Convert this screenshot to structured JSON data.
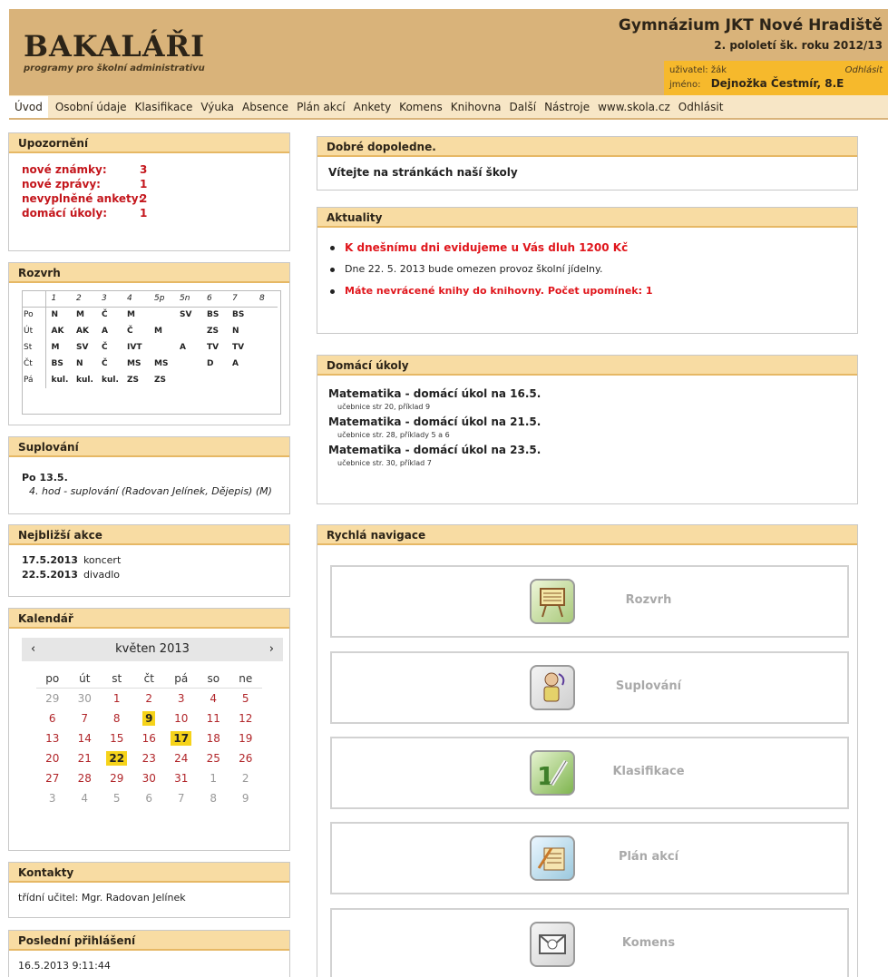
{
  "header": {
    "logo": "BAKALÁŘI",
    "logo_sub": "programy pro školní administrativu",
    "school": "Gymnázium JKT Nové Hradiště",
    "semester": "2. pololetí šk. roku 2012/13",
    "user_label": "uživatel:",
    "user_value": "žák",
    "logout": "Odhlásit",
    "name_label": "jméno:",
    "name_value": "Dejnožka Čestmír, 8.E"
  },
  "nav": [
    "Úvod",
    "Osobní údaje",
    "Klasifikace",
    "Výuka",
    "Absence",
    "Plán akcí",
    "Ankety",
    "Komens",
    "Knihovna",
    "Další",
    "Nástroje",
    "www.skola.cz",
    "Odhlásit"
  ],
  "upozorneni": {
    "title": "Upozornění",
    "rows": [
      {
        "label": "nové známky:",
        "value": "3"
      },
      {
        "label": "nové zprávy:",
        "value": "1"
      },
      {
        "label": "nevyplněné ankety:",
        "value": "2"
      },
      {
        "label": "domácí úkoly:",
        "value": "1"
      }
    ]
  },
  "rozvrh": {
    "title": "Rozvrh",
    "headers": [
      "1",
      "2",
      "3",
      "4",
      "5p",
      "5n",
      "6",
      "7",
      "8"
    ],
    "days": [
      {
        "day": "Po",
        "cells": [
          "N",
          "M",
          "Č",
          "M",
          "",
          "SV",
          "BS",
          "BS",
          ""
        ]
      },
      {
        "day": "Út",
        "cells": [
          "AK",
          "AK",
          "A",
          "Č",
          "M",
          "",
          "ZS",
          "N",
          ""
        ]
      },
      {
        "day": "St",
        "cells": [
          "M",
          "SV",
          "Č",
          "IVT",
          "",
          "A",
          "TV",
          "TV",
          ""
        ]
      },
      {
        "day": "Čt",
        "cells": [
          "BS",
          "N",
          "Č",
          "MS",
          "MS",
          "",
          "D",
          "A",
          ""
        ]
      },
      {
        "day": "Pá",
        "cells": [
          "kul.",
          "kul.",
          "kul.",
          "ZS",
          "ZS",
          "",
          "",
          "",
          ""
        ]
      }
    ]
  },
  "suplovani": {
    "title": "Suplování",
    "date": "Po 13.5.",
    "line": "4. hod - suplování (Radovan Jelínek, Dějepis) (M)"
  },
  "akce": {
    "title": "Nejbližší akce",
    "rows": [
      {
        "date": "17.5.2013",
        "name": "koncert"
      },
      {
        "date": "22.5.2013",
        "name": "divadlo"
      }
    ]
  },
  "kalendar": {
    "title": "Kalendář",
    "month": "květen 2013",
    "prev": "‹",
    "next": "›",
    "dow": [
      "po",
      "út",
      "st",
      "čt",
      "pá",
      "so",
      "ne"
    ],
    "days": [
      "29",
      "30",
      "1",
      "2",
      "3",
      "4",
      "5",
      "6",
      "7",
      "8",
      "9",
      "10",
      "11",
      "12",
      "13",
      "14",
      "15",
      "16",
      "17",
      "18",
      "19",
      "20",
      "21",
      "22",
      "23",
      "24",
      "25",
      "26",
      "27",
      "28",
      "29",
      "30",
      "31",
      "1",
      "2",
      "3",
      "4",
      "5",
      "6",
      "7",
      "8",
      "9"
    ]
  },
  "kontakty": {
    "title": "Kontakty",
    "text": "třídní učitel: Mgr. Radovan Jelínek"
  },
  "prihlaseni": {
    "title": "Poslední přihlášení",
    "text": "16.5.2013 9:11:44"
  },
  "greeting": {
    "title": "Dobré dopoledne.",
    "text": "Vítejte na stránkách naší školy"
  },
  "aktuality": {
    "title": "Aktuality",
    "items": [
      "K dnešnímu dni evidujeme u Vás dluh 1200 Kč",
      "Dne 22. 5. 2013 bude omezen provoz školní jídelny.",
      "Máte nevrácené knihy do knihovny. Počet upomínek: 1"
    ]
  },
  "ukoly": {
    "title": "Domácí úkoly",
    "items": [
      {
        "title": "Matematika - domácí úkol na 16.5.",
        "note": "učebnice str 20, příklad 9"
      },
      {
        "title": "Matematika - domácí úkol na 21.5.",
        "note": "učebnice str. 28, příklady 5 a 6"
      },
      {
        "title": "Matematika - domácí úkol na 23.5.",
        "note": "učebnice str. 30, příklad 7"
      }
    ]
  },
  "navigace": {
    "title": "Rychlá navigace",
    "buttons": [
      "Rozvrh",
      "Suplování",
      "Klasifikace",
      "Plán akcí",
      "Komens"
    ]
  }
}
